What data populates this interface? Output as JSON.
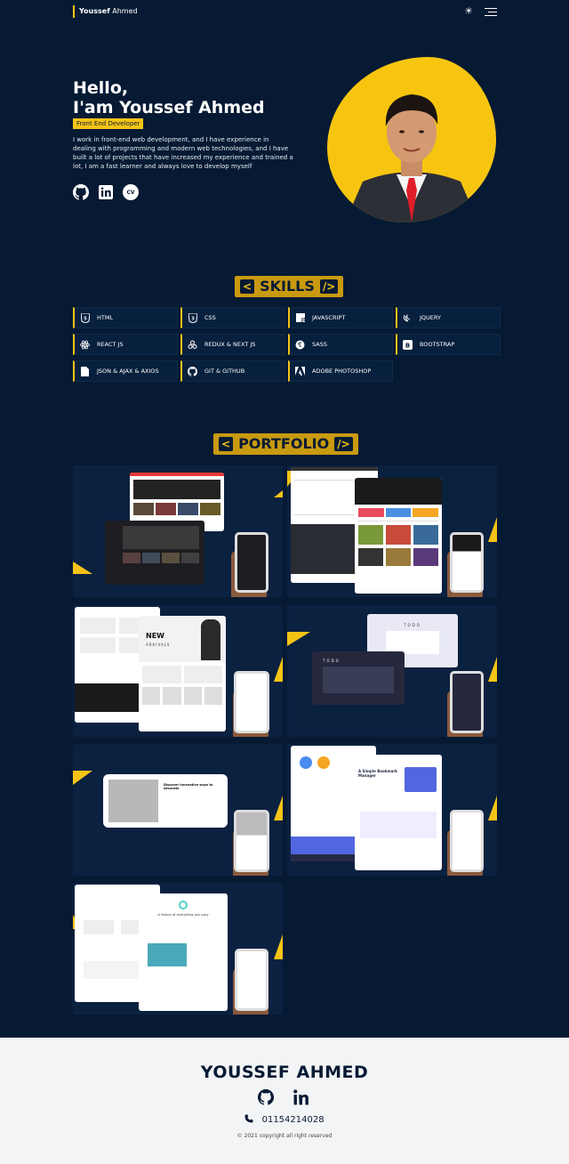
{
  "header": {
    "brand_first": "Youssef",
    "brand_last": "Ahmed",
    "theme_icon": "sun-icon",
    "menu_icon": "hamburger-menu-icon"
  },
  "hero": {
    "greeting": "Hello,",
    "headline": "I'am Youssef Ahmed",
    "role": "Front End Developer",
    "intro": "I work in front-end web development, and I have experience in dealing with programming and modern web technologies, and I have built a lot of projects that have increased my experience and trained a lot, I am a fast learner and always love to develop myself",
    "cv_label": "CV",
    "accent_color": "#f6c417"
  },
  "skills": {
    "title": "SKILLS",
    "bracket_left": "<",
    "bracket_right": "/>",
    "items": [
      {
        "label": "HTML",
        "icon": "html5-icon"
      },
      {
        "label": "CSS",
        "icon": "css3-icon"
      },
      {
        "label": "JAVASCRIPT",
        "icon": "javascript-icon"
      },
      {
        "label": "JQUERY",
        "icon": "jquery-icon"
      },
      {
        "label": "REACT JS",
        "icon": "react-icon"
      },
      {
        "label": "REDUX & NEXT JS",
        "icon": "redux-icon"
      },
      {
        "label": "SASS",
        "icon": "sass-icon"
      },
      {
        "label": "BOOTSTRAP",
        "icon": "bootstrap-icon"
      },
      {
        "label": "JSON & AJAX & AXIOS",
        "icon": "file-icon"
      },
      {
        "label": "GIT & GITHUB",
        "icon": "github-icon"
      },
      {
        "label": "ADOBE PHOTOSHOP",
        "icon": "adobe-icon"
      }
    ]
  },
  "portfolio": {
    "title": "PORTFOLIO",
    "bracket_left": "<",
    "bracket_right": "/>",
    "projects": [
      {
        "name": "video-streaming-project"
      },
      {
        "name": "bookstore-project"
      },
      {
        "name": "ecommerce-fashion-project"
      },
      {
        "name": "todo-app-project"
      },
      {
        "name": "interior-design-landing-project"
      },
      {
        "name": "bookmark-manager-project"
      },
      {
        "name": "saas-landing-project"
      }
    ],
    "card_texts": {
      "new_arrivals": "NEW",
      "arrivals": "ARRIVALS",
      "todo": "TODO",
      "discover": "Discover innovative ways to decorate",
      "bookmark": "A Simple Bookmark Manager",
      "history": "A history of everything you copy"
    }
  },
  "footer": {
    "name": "YOUSSEF AHMED",
    "phone": "01154214028",
    "copyright": "© 2021 copyright all right reserved",
    "bg_color": "#f3f4f6"
  }
}
